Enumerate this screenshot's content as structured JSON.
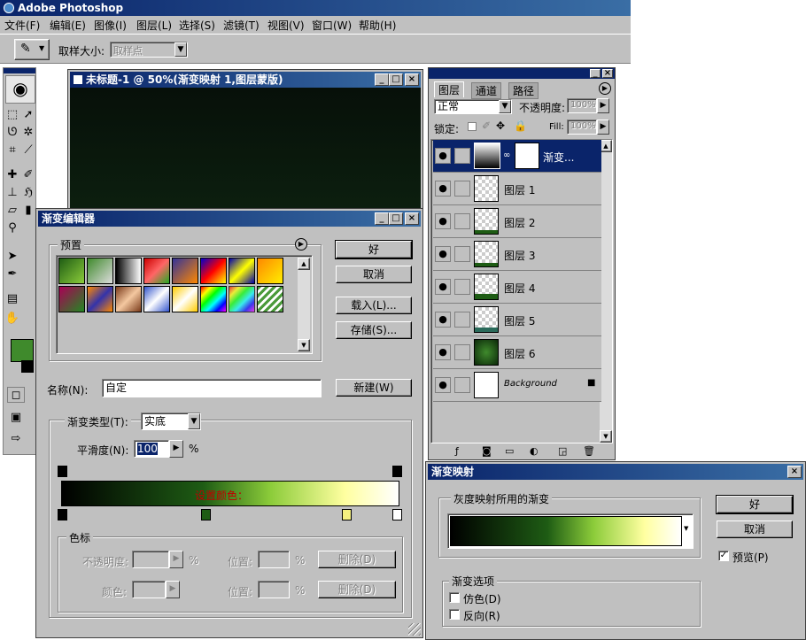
{
  "app": {
    "title": "Adobe Photoshop",
    "menu": [
      "文件(F)",
      "编辑(E)",
      "图像(I)",
      "图层(L)",
      "选择(S)",
      "滤镜(T)",
      "视图(V)",
      "窗口(W)",
      "帮助(H)"
    ]
  },
  "options_bar": {
    "sample_size_label": "取样大小:",
    "sample_size_value": "取样点"
  },
  "document": {
    "title": "未标题-1 @ 50%(渐变映射 1,图层蒙版)"
  },
  "gradient_editor": {
    "title": "渐变编辑器",
    "presets_label": "预置",
    "ok": "好",
    "cancel": "取消",
    "load": "载入(L)...",
    "save": "存储(S)...",
    "name_label": "名称(N):",
    "name_value": "自定",
    "new_button": "新建(W)",
    "type_label": "渐变类型(T):",
    "type_value": "实底",
    "smooth_label": "平滑度(N):",
    "smooth_value": "100",
    "smooth_unit": "%",
    "bar_overlay_text": "设置颜色：",
    "color_stops_group": "色标",
    "opacity_label": "不透明度:",
    "opacity_unit": "%",
    "location_label": "位置:",
    "location_unit": "%",
    "delete_button": "删除(D)",
    "color_label": "颜色:",
    "location2_label": "位置:",
    "location2_unit": "%",
    "delete2_button": "删除(D)"
  },
  "layers": {
    "tabs": [
      "图层",
      "通道",
      "路径"
    ],
    "blend_mode": "正常",
    "opacity_label": "不透明度:",
    "opacity_value": "100%",
    "lock_label": "锁定:",
    "fill_label": "Fill:",
    "fill_value": "100%",
    "rows": [
      {
        "name": "渐变..."
      },
      {
        "name": "图层 1"
      },
      {
        "name": "图层 2"
      },
      {
        "name": "图层 3"
      },
      {
        "name": "图层 4"
      },
      {
        "name": "图层 5"
      },
      {
        "name": "图层 6"
      },
      {
        "name": "Background"
      }
    ]
  },
  "gradient_map": {
    "title": "渐变映射",
    "group_label": "灰度映射所用的渐变",
    "ok": "好",
    "cancel": "取消",
    "preview_label": "预览(P)",
    "options_group": "渐变选项",
    "dither_label": "仿色(D)",
    "reverse_label": "反向(R)"
  },
  "colors": {
    "foreground": "#3f8a2c",
    "gradient": [
      "#000000",
      "#1e5c14",
      "#8ccc3a",
      "#ffffa0",
      "#ffffff"
    ]
  }
}
